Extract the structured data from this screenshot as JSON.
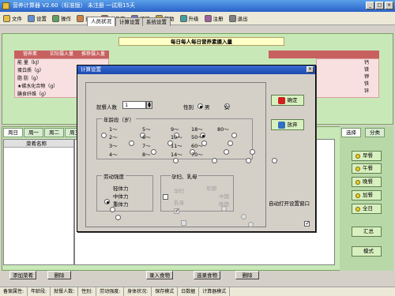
{
  "window": {
    "title": "营养计算器 V2.60（标准版） 未注册 一试用15天"
  },
  "toolbar": {
    "items": [
      {
        "label": "文件",
        "icon": "file-icon"
      },
      {
        "label": "设置",
        "icon": "settings-icon"
      },
      {
        "label": "操作",
        "icon": "operate-icon"
      },
      {
        "label": "查询",
        "icon": "query-icon"
      },
      {
        "label": "食品库",
        "icon": "food-library-icon"
      },
      {
        "label": "打印",
        "icon": "print-icon"
      },
      {
        "label": "帮助",
        "icon": "help-icon"
      },
      {
        "label": "升级",
        "icon": "upgrade-icon"
      },
      {
        "label": "注册",
        "icon": "register-icon"
      },
      {
        "label": "退出",
        "icon": "exit-icon"
      }
    ]
  },
  "nutrients": {
    "heading": "每日每人每日营养素摄入量",
    "col_headers": [
      "营养素",
      "实际摄入量",
      "推荐摄入量"
    ],
    "rows": [
      "能 量（kJ）",
      "蛋白质（g）",
      "脂 肪（g）",
      "★碳水化合物（g）",
      "膳食纤维（g）"
    ],
    "right_labels": [
      "钙",
      "镁",
      "钾",
      "铁",
      "锌"
    ]
  },
  "left_tabs": [
    "早餐",
    "午餐",
    "晚餐",
    "加餐",
    "全日"
  ],
  "left_tab_short": [
    "周日",
    "周一",
    "周二",
    "周三"
  ],
  "list": {
    "header": "菜肴名称"
  },
  "bottom_buttons": {
    "add_dish": "添加菜肴",
    "delete": "删除",
    "enter_food": "录入食物",
    "select_food": "选录食物",
    "delete2": "删除"
  },
  "right_tabs": [
    "选择",
    "分类"
  ],
  "meals": [
    "早餐",
    "午餐",
    "晚餐",
    "加餐",
    "全日"
  ],
  "right_extra": [
    "汇总",
    "模式"
  ],
  "status": [
    "备案属性:",
    "年龄段:",
    "就餐人数:",
    "性别:",
    "劳动强度:",
    "身体状况:",
    "保存模式",
    "日数据",
    "计算器模式"
  ],
  "dialog": {
    "title": "计算设置",
    "tabs": [
      "人员状况",
      "计算设置",
      "系统设置"
    ],
    "diners_label": "就餐人数",
    "diners_value": "1",
    "gender_label": "性别",
    "gender_options": [
      "男",
      "女"
    ],
    "gender_selected": "男",
    "age_legend": "年龄段（岁）",
    "age_options": [
      [
        "1～",
        "5～",
        "9～",
        "18～",
        "80～"
      ],
      [
        "2～",
        "6～",
        "10～",
        "50～"
      ],
      [
        "3～",
        "7～",
        "11～",
        "60～"
      ],
      [
        "4～",
        "8～",
        "14～",
        "70～"
      ]
    ],
    "age_selected": "18～",
    "labor_legend": "劳动强度",
    "labor_options": [
      "轻体力",
      "中体力",
      "重体力"
    ],
    "labor_selected": "轻体力",
    "pregnant_label": "孕妇、乳母",
    "preg_sub": [
      "孕妇",
      "乳母",
      "早期",
      "中期",
      "晚期"
    ],
    "ok": "确定",
    "cancel": "放弃",
    "auto_open": "自动打开设置窗口"
  }
}
